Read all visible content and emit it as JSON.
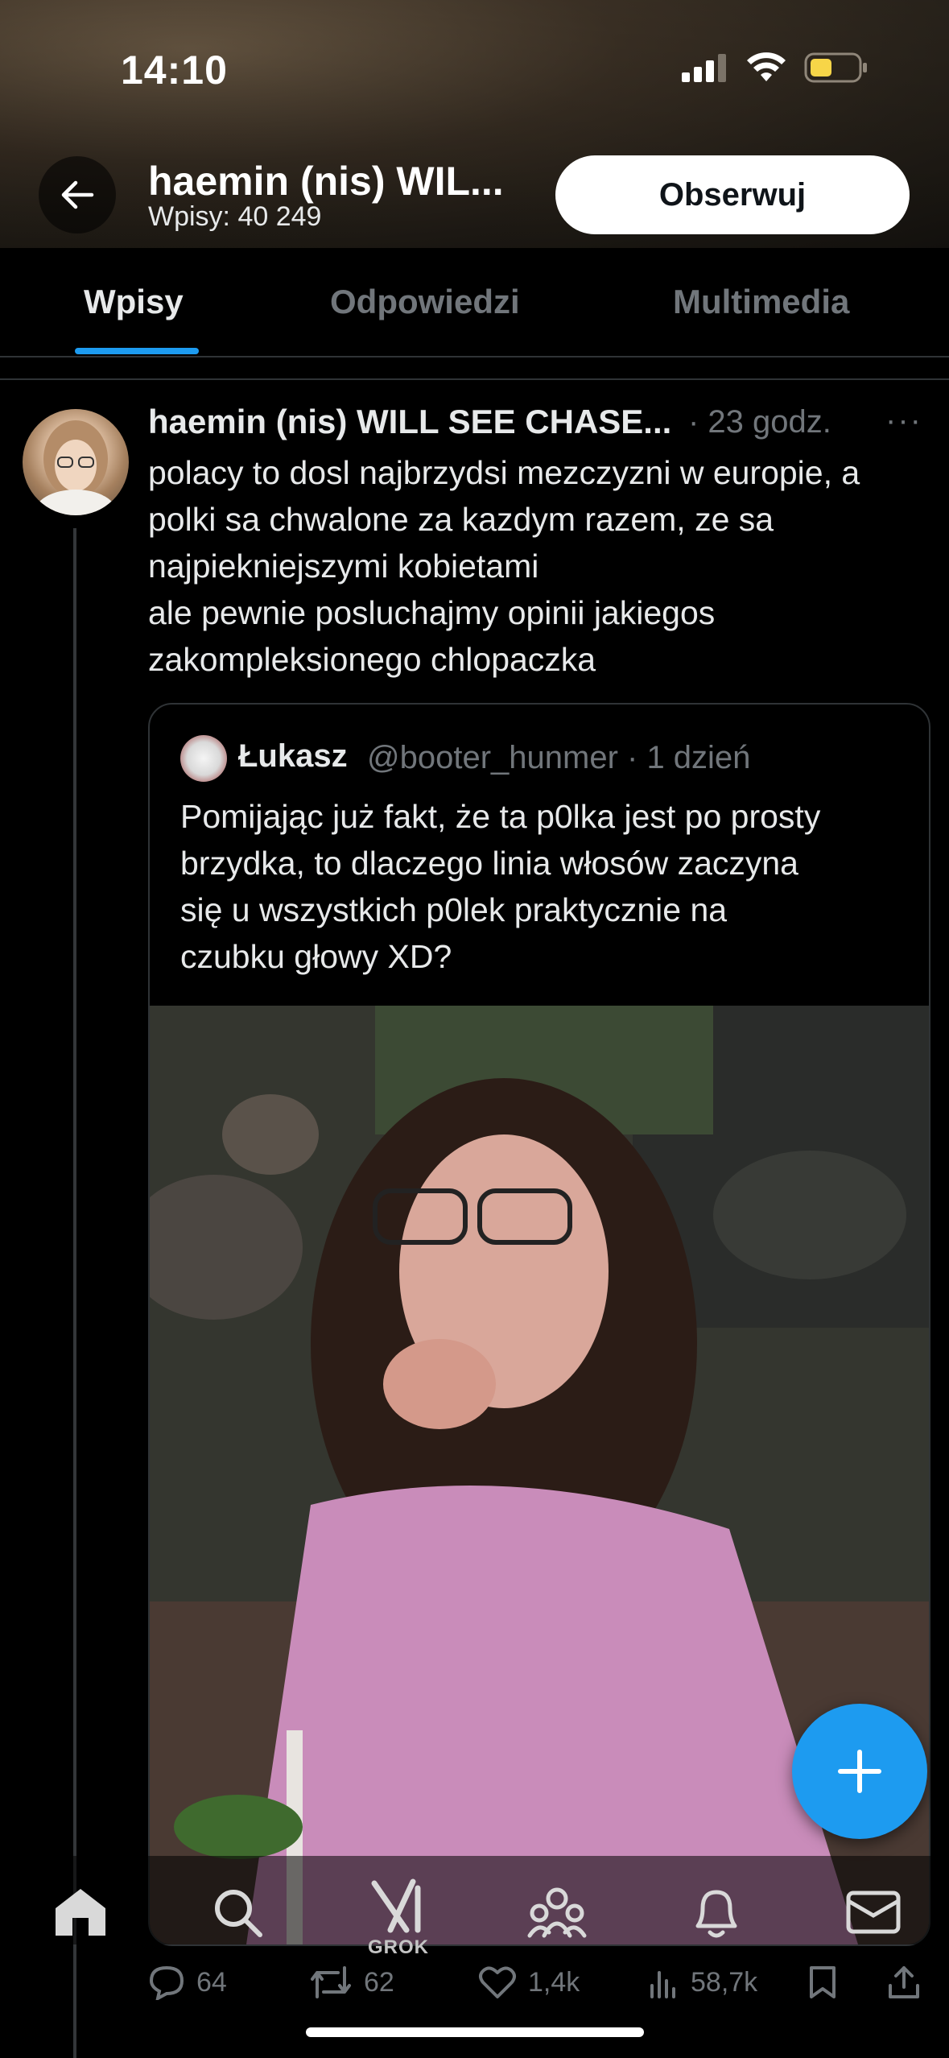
{
  "status_bar": {
    "time": "14:10"
  },
  "header": {
    "name": "haemin (nis) WIL...",
    "post_count": "Wpisy: 40 249",
    "follow_label": "Obserwuj"
  },
  "tabs": [
    {
      "label": "Wpisy",
      "active": true
    },
    {
      "label": "Odpowiedzi",
      "active": false
    },
    {
      "label": "Multimedia",
      "active": false
    }
  ],
  "tweet": {
    "author": "haemin (nis) WILL SEE CHASE...",
    "time": "· 23 godz.",
    "more": "···",
    "text_lines": [
      "polacy to dosl najbrzydsi mezczyzni w europie, a",
      "polki sa chwalone za kazdym razem, ze sa",
      "najpiekniejszymi kobietami",
      "ale pewnie posluchajmy opinii jakiegos",
      "zakompleksionego chlopaczka"
    ],
    "quote": {
      "name": "Łukasz",
      "handle": "@booter_hunmer · 1 dzień",
      "text_lines": [
        "Pomijając już fakt, że ta p0lka jest po prosty",
        "brzydka, to dlaczego linia włosów zaczyna",
        "się u wszystkich p0lek praktycznie na",
        "czubku głowy XD?"
      ]
    },
    "actions": {
      "replies": "64",
      "reposts": "62",
      "likes": "1,4k",
      "views": "58,7k"
    }
  },
  "bottom_nav": {
    "grok_label": "GROK"
  },
  "colors": {
    "accent": "#1d9bf0",
    "background": "#000000",
    "secondary_text": "#71767b"
  }
}
